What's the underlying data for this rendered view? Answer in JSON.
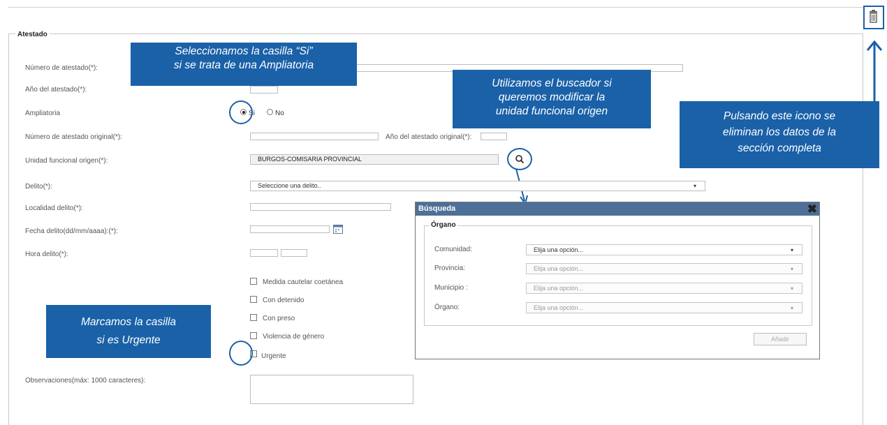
{
  "section": {
    "title": "Atestado"
  },
  "fields": {
    "numero_atestado": "Número de atestado(*):",
    "anio_atestado": "Año del atestado(*):",
    "ampliatoria": "Ampliatoria",
    "ampliatoria_si": "Si",
    "ampliatoria_no": "No",
    "numero_original": "Número de atestado original(*):",
    "anio_original": "Año del atestado original(*):",
    "unidad_funcional": "Unidad funcional origen(*):",
    "unidad_funcional_value": "BURGOS-COMISARIA PROVINCIAL",
    "delito": "Delito(*):",
    "delito_placeholder": "Seleccione una delito..",
    "localidad": "Localidad delito(*):",
    "fecha": "Fecha delito(dd/mm/aaaa):(*):",
    "hora": "Hora delito(*):",
    "observaciones": "Observaciones(máx: 1000 caracteres):"
  },
  "checkboxes": [
    {
      "label": "Medida cautelar coetánea"
    },
    {
      "label": "Con detenido"
    },
    {
      "label": "Con preso"
    },
    {
      "label": "Violencia de género"
    },
    {
      "label": "Urgente"
    }
  ],
  "callouts": {
    "ampliatoria_line1": "Seleccionamos la casilla “Si”",
    "ampliatoria_line2": "si se trata de una Ampliatoria",
    "buscador_line1": "Utilizamos el buscador si",
    "buscador_line2": "queremos modificar  la",
    "buscador_line3": "unidad funcional origen",
    "papelera_line1": "Pulsando este icono se",
    "papelera_line2": "eliminan los datos de la",
    "papelera_line3": "sección completa",
    "urgente_line1": "Marcamos la casilla",
    "urgente_line2": "si es Urgente"
  },
  "modal": {
    "title": "Búsqueda",
    "group": "Órgano",
    "rows": [
      {
        "label": "Comunidad:",
        "value": "Elija una opción...",
        "disabled": false
      },
      {
        "label": "Provincia:",
        "value": "Elija una opción...",
        "disabled": true
      },
      {
        "label": "Municipio :",
        "value": "Elija una opción...",
        "disabled": true
      },
      {
        "label": "Órgano:",
        "value": "Elija una opción...",
        "disabled": true
      }
    ],
    "add_button": "Añadir"
  },
  "colors": {
    "callout": "#1a61a8",
    "modal_header": "#4e6f97"
  },
  "icons": {
    "trash": "trash-icon",
    "search": "search-icon",
    "calendar": "calendar-icon",
    "close": "close-icon"
  }
}
